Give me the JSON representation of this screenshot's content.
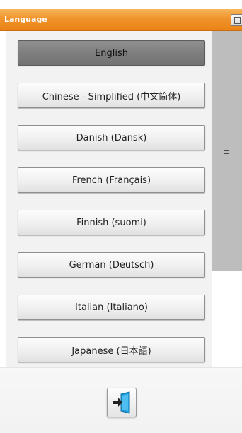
{
  "window": {
    "title": "Language"
  },
  "languages": [
    {
      "label": "English",
      "selected": true
    },
    {
      "label": "Chinese - Simplified (中文简体)",
      "selected": false
    },
    {
      "label": "Danish (Dansk)",
      "selected": false
    },
    {
      "label": "French (Français)",
      "selected": false
    },
    {
      "label": "Finnish (suomi)",
      "selected": false
    },
    {
      "label": "German (Deutsch)",
      "selected": false
    },
    {
      "label": "Italian (Italiano)",
      "selected": false
    },
    {
      "label": "Japanese (日本語)",
      "selected": false
    }
  ],
  "icons": {
    "title_control": "restore-window-icon",
    "scroll_grip": "scroll-grip-icon",
    "exit": "exit-door-icon"
  },
  "colors": {
    "titlebar": "#f0932b",
    "selected_button": "#7f7f7f",
    "scroll_thumb": "#bdbdbd",
    "exit_door": "#1e9ad6"
  }
}
